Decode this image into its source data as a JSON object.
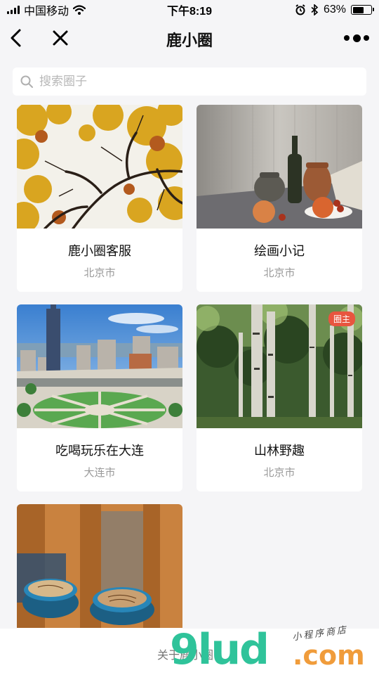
{
  "status_bar": {
    "carrier": "中国移动",
    "time": "下午8:19",
    "battery_percent": "63%",
    "battery_level": 0.63,
    "icons": [
      "signal-icon",
      "wifi-icon",
      "alarm-icon",
      "bluetooth-icon",
      "battery-icon"
    ]
  },
  "nav": {
    "title": "鹿小圈",
    "icons": [
      "back-arrow-icon",
      "close-icon",
      "more-icon"
    ]
  },
  "search": {
    "placeholder": "搜索圈子",
    "value": ""
  },
  "circles": [
    {
      "name": "鹿小圈客服",
      "city": "北京市",
      "image": "autumn-tree-branches"
    },
    {
      "name": "绘画小记",
      "city": "北京市",
      "image": "still-life-pottery"
    },
    {
      "name": "吃喝玩乐在大连",
      "city": "大连市",
      "image": "city-square-aerial"
    },
    {
      "name": "山林野趣",
      "city": "北京市",
      "image": "birch-forest",
      "badge": "圈主"
    },
    {
      "name": "",
      "city": "",
      "image": "coffee-cups-on-table"
    }
  ],
  "footer": {
    "about_label": "关于鹿小圈"
  },
  "watermark": {
    "brand": "9lud",
    "domain": ".com",
    "tagline": "小程序商店"
  },
  "colors": {
    "background": "#f5f5f7",
    "badge": "#e8553f",
    "watermark_green": "#2fc39a",
    "watermark_orange": "#f09c3b"
  }
}
